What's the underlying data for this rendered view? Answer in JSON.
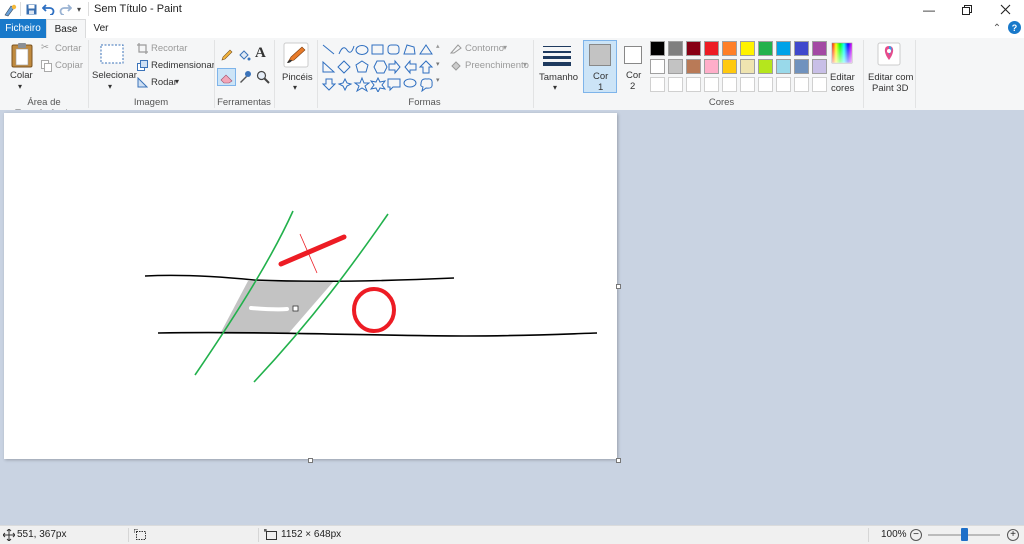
{
  "window": {
    "title": "Sem Título - Paint",
    "help_glyph": "?"
  },
  "tabs": [
    {
      "label": "Ficheiro"
    },
    {
      "label": "Base"
    },
    {
      "label": "Ver"
    }
  ],
  "ribbon": {
    "clipboard": {
      "paste_label": "Colar",
      "cut_label": "Cortar",
      "copy_label": "Copiar",
      "group_label": "Área de Transferência"
    },
    "image": {
      "select_label": "Selecionar",
      "crop_label": "Recortar",
      "resize_label": "Redimensionar",
      "rotate_label": "Rodar",
      "group_label": "Imagem"
    },
    "tools": {
      "group_label": "Ferramentas",
      "text_glyph": "A"
    },
    "brushes": {
      "label": "Pincéis"
    },
    "shapes": {
      "outline_label": "Contorno",
      "fill_label": "Preenchimento",
      "group_label": "Formas"
    },
    "size": {
      "label": "Tamanho"
    },
    "colors": {
      "color1_label": "Cor",
      "color1_num": "1",
      "color2_label": "Cor",
      "color2_num": "2",
      "color1_value": "#c3c3c3",
      "color2_value": "#ffffff",
      "palette_row1": [
        "#000000",
        "#7f7f7f",
        "#880015",
        "#ed1c24",
        "#ff7f27",
        "#fff200",
        "#22b14c",
        "#00a2e8",
        "#3f48cc",
        "#a349a4"
      ],
      "palette_row2": [
        "#ffffff",
        "#c3c3c3",
        "#b97a57",
        "#ffaec9",
        "#ffc90e",
        "#efe4b0",
        "#b5e61d",
        "#99d9ea",
        "#7092be",
        "#c8bfe7"
      ],
      "group_label": "Cores",
      "edit_label_1": "Editar",
      "edit_label_2": "cores"
    },
    "paint3d": {
      "label_1": "Editar com",
      "label_2": "Paint 3D"
    }
  },
  "statusbar": {
    "cursor_pos": "551, 367px",
    "image_size": "1152 × 648px",
    "zoom": "100%",
    "zoom_level": 0.5
  },
  "drawing": {
    "line_color": "#000000",
    "green": "#22b14c",
    "red": "#ed1c24",
    "fill_gray": "#c3c3c3"
  }
}
